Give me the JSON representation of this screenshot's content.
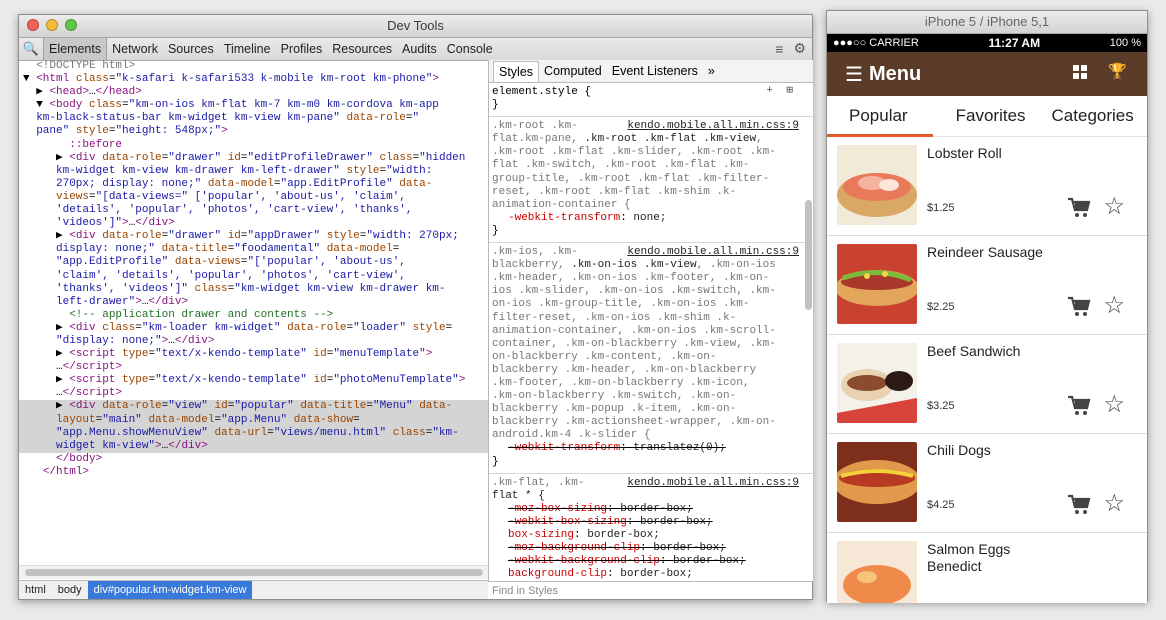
{
  "devtools": {
    "title": "Dev Tools",
    "tabs": [
      "Elements",
      "Network",
      "Sources",
      "Timeline",
      "Profiles",
      "Resources",
      "Audits",
      "Console"
    ],
    "active_tab": "Elements",
    "breadcrumbs": [
      "html",
      "body",
      "div#popular.km-widget.km-view"
    ],
    "sidebar_tabs": [
      "Styles",
      "Computed",
      "Event Listeners",
      "»"
    ],
    "find_placeholder": "Find in Styles",
    "element_style": "element.style {",
    "rule1_source": "kendo.mobile.all.min.css:9",
    "rule2_source": "kendo.mobile.all.min.css:9",
    "rule3_source": "kendo.mobile.all.min.css:9"
  },
  "iphone": {
    "title": "iPhone 5 / iPhone 5,1",
    "carrier": "●●●○○ CARRIER",
    "time": "11:27 AM",
    "battery": "100 %",
    "nav_title": "Menu",
    "categories": [
      "Popular",
      "Favorites",
      "Categories"
    ],
    "items": [
      {
        "name": "Lobster Roll",
        "price": "$1.25"
      },
      {
        "name": "Reindeer Sausage",
        "price": "$2.25"
      },
      {
        "name": "Beef Sandwich",
        "price": "$3.25"
      },
      {
        "name": "Chili Dogs",
        "price": "$4.25"
      },
      {
        "name": "Salmon Eggs Benedict",
        "price": ""
      }
    ]
  }
}
